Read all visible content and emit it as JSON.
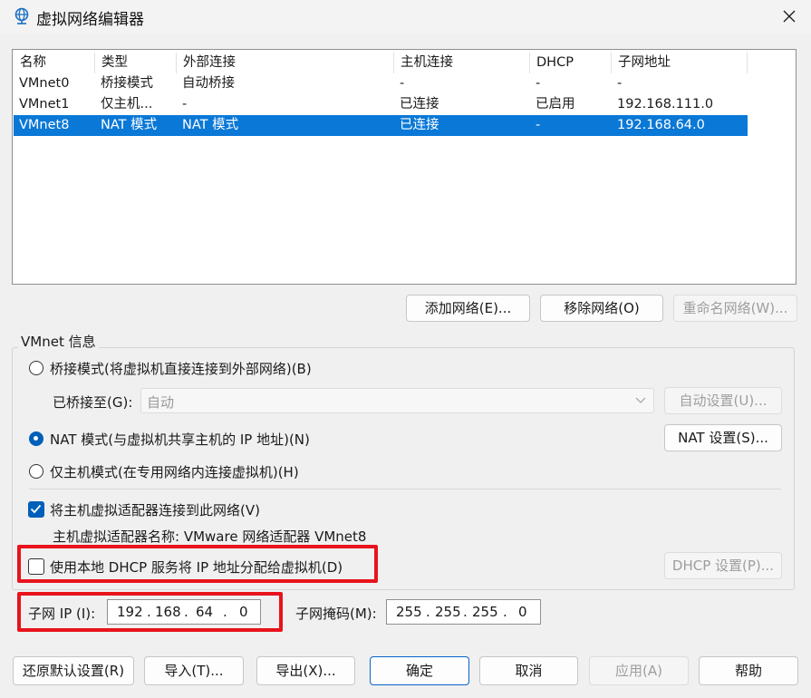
{
  "window": {
    "title": "虚拟网络编辑器",
    "icon": "globe-network-icon"
  },
  "table": {
    "columns": [
      "名称",
      "类型",
      "外部连接",
      "主机连接",
      "DHCP",
      "子网地址"
    ],
    "rows": [
      [
        "VMnet0",
        "桥接模式",
        "自动桥接",
        "-",
        "-",
        "-"
      ],
      [
        "VMnet1",
        "仅主机...",
        "-",
        "已连接",
        "已启用",
        "192.168.111.0"
      ],
      [
        "VMnet8",
        "NAT 模式",
        "NAT 模式",
        "已连接",
        "-",
        "192.168.64.0"
      ]
    ],
    "selected_row": 2
  },
  "table_buttons": {
    "add": "添加网络(E)...",
    "remove": "移除网络(O)",
    "rename": "重命名网络(W)..."
  },
  "info": {
    "group_title": "VMnet 信息",
    "bridged_radio": "桥接模式(将虚拟机直接连接到外部网络)(B)",
    "bridged_to_label": "已桥接至(G):",
    "bridged_to_value": "自动",
    "auto_settings": "自动设置(U)...",
    "nat_radio": "NAT 模式(与虚拟机共享主机的 IP 地址)(N)",
    "nat_settings": "NAT 设置(S)...",
    "hostonly_radio": "仅主机模式(在专用网络内连接虚拟机)(H)",
    "connect_adapter_check": "将主机虚拟适配器连接到此网络(V)",
    "adapter_name": "主机虚拟适配器名称: VMware 网络适配器 VMnet8",
    "dhcp_check": "使用本地 DHCP 服务将 IP 地址分配给虚拟机(D)",
    "dhcp_settings": "DHCP 设置(P)...",
    "selected_mode": "nat",
    "connect_adapter_checked": true,
    "dhcp_checked": false
  },
  "subnet": {
    "ip_label": "子网 IP (I):",
    "ip": [
      "192",
      "168",
      "64",
      "0"
    ],
    "mask_label": "子网掩码(M):",
    "mask": [
      "255",
      "255",
      "255",
      "0"
    ]
  },
  "footer": {
    "restore": "还原默认设置(R)",
    "import": "导入(T)...",
    "export": "导出(X)...",
    "ok": "确定",
    "cancel": "取消",
    "apply": "应用(A)",
    "help": "帮助"
  },
  "colors": {
    "selection": "#0a78d7",
    "highlight_box": "#e8131b",
    "accent": "#005fb8"
  }
}
